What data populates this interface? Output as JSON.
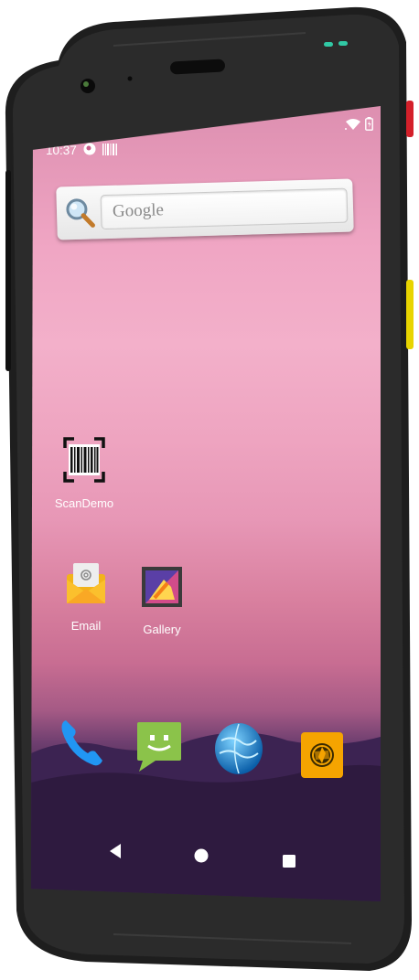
{
  "status_bar": {
    "time": "10:37",
    "icons": [
      "notification-icon",
      "barcode-notification-icon",
      "wifi-icon",
      "battery-icon"
    ]
  },
  "search_widget": {
    "placeholder": "Google",
    "icon": "magnifier-icon"
  },
  "apps": [
    {
      "label": "ScanDemo",
      "icon": "barcode-scanner-icon"
    },
    {
      "label": "Email",
      "icon": "email-icon"
    },
    {
      "label": "Gallery",
      "icon": "gallery-icon"
    }
  ],
  "dock": [
    {
      "icon": "phone-icon"
    },
    {
      "icon": "messaging-icon"
    },
    {
      "icon": "browser-icon"
    },
    {
      "icon": "camera-icon"
    }
  ],
  "nav_bar": {
    "buttons": [
      "back-button",
      "home-button",
      "recents-button"
    ]
  },
  "colors": {
    "wallpaper_top": "#dd8fb0",
    "wallpaper_mid": "#f3b0ca",
    "wallpaper_bottom": "#2a1836",
    "phone_frame": "#1c1c1c",
    "side_key_red": "#d4202a",
    "side_key_yellow": "#e8d400",
    "led": "#31c9a5"
  }
}
